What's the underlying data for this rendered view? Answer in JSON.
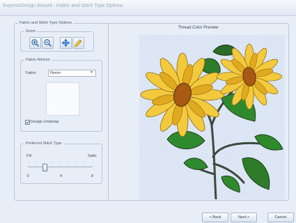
{
  "window": {
    "title": "ExpressDesign Wizard - Fabric and Stitch Type Options"
  },
  "options_group": {
    "title": "Fabric and Stitch Type Options",
    "zoom": {
      "title": "Zoom",
      "tools": [
        "zoom-in-icon",
        "zoom-out-icon",
        "pan-icon",
        "zoom-fit-icon"
      ]
    },
    "fabric_advisor": {
      "title": "Fabric Advisor",
      "fabric_label": "Fabric",
      "fabric_value": "Fleece",
      "design_underlay_label": "Design Underlay",
      "design_underlay_checked": true
    },
    "stitch_type": {
      "title": "Preferred Stitch Type",
      "left_label": "Fill",
      "right_label": "Satin",
      "ticks": [
        "0",
        "4",
        "8"
      ],
      "value": 2
    }
  },
  "preview": {
    "title": "Thread Color Preview"
  },
  "buttons": {
    "back": "< Back",
    "next": "Next >",
    "cancel": "Cancel"
  }
}
